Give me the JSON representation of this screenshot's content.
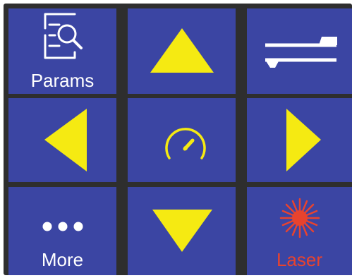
{
  "colors": {
    "tile_background": "#3b45a3",
    "grid_lines": "#2e2e2e",
    "arrow_yellow": "#f5ea12",
    "icon_white": "#ffffff",
    "laser_red": "#e8432e"
  },
  "tiles": [
    {
      "id": "params",
      "label": "Params",
      "icon": "document-search-icon"
    },
    {
      "id": "move-up",
      "icon": "arrow-up-icon"
    },
    {
      "id": "swap",
      "icon": "swap-direction-icon"
    },
    {
      "id": "move-left",
      "icon": "arrow-left-icon"
    },
    {
      "id": "speed",
      "icon": "speedometer-icon"
    },
    {
      "id": "move-right",
      "icon": "arrow-right-icon"
    },
    {
      "id": "more",
      "label": "More",
      "icon": "more-dots-icon"
    },
    {
      "id": "move-down",
      "icon": "arrow-down-icon"
    },
    {
      "id": "laser",
      "label": "Laser",
      "icon": "laser-burst-icon"
    }
  ]
}
